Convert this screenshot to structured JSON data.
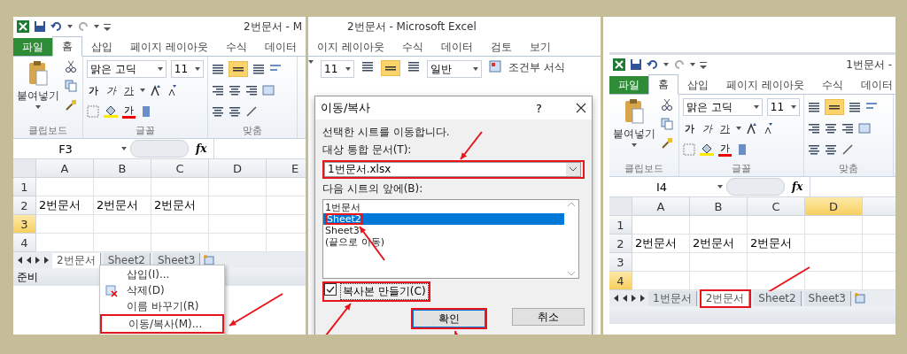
{
  "panels": [
    {
      "kind": "excel",
      "title": "2번문서 - M",
      "ribbon_tabs": [
        {
          "label": "파일",
          "kind": "file",
          "selected": false
        },
        {
          "label": "홈",
          "kind": "tab",
          "selected": true
        },
        {
          "label": "삽입",
          "kind": "tab",
          "selected": false
        },
        {
          "label": "페이지 레이아웃",
          "kind": "tab",
          "selected": false
        },
        {
          "label": "수식",
          "kind": "tab",
          "selected": false
        },
        {
          "label": "데이터",
          "kind": "tab",
          "selected": false
        }
      ],
      "ribbon": {
        "paste": "붙여넣기",
        "font_name": "맑은 고딕",
        "font_size": "11",
        "style_buttons": [
          "가",
          "가",
          "가"
        ],
        "font_color": "가",
        "groups": [
          "클립보드",
          "글꼴",
          "맞춤"
        ]
      },
      "name_box": "F3",
      "fx": "fx",
      "columns": [
        {
          "label": "A",
          "selected": false
        },
        {
          "label": "B",
          "selected": false
        },
        {
          "label": "C",
          "selected": false
        },
        {
          "label": "D",
          "selected": false
        },
        {
          "label": "E",
          "selected": false
        }
      ],
      "rows": [
        {
          "label": "1",
          "selected": false,
          "cells": []
        },
        {
          "label": "2",
          "selected": false,
          "cells": [
            "2번문서",
            "2번문서",
            "2번문서"
          ]
        },
        {
          "label": "3",
          "selected": true,
          "cells": []
        },
        {
          "label": "4",
          "selected": false,
          "cells": []
        }
      ],
      "sheet_tabs": [
        {
          "label": "2번문서",
          "selected": true,
          "highlighted": false
        },
        {
          "label": "Sheet2",
          "selected": false,
          "highlighted": false
        },
        {
          "label": "Sheet3",
          "selected": false,
          "highlighted": false
        }
      ],
      "status": "준비",
      "context_menu": [
        {
          "label": "삽입(I)...",
          "kind": "plain",
          "highlighted": false
        },
        {
          "label": "삭제(D)",
          "kind": "delete",
          "highlighted": false
        },
        {
          "label": "이름 바꾸기(R)",
          "kind": "plain",
          "highlighted": false
        },
        {
          "label": "이동/복사(M)...",
          "kind": "plain",
          "highlighted": true,
          "arrow": {
            "kind": "from-upper-right"
          }
        }
      ]
    },
    {
      "kind": "dialog-step",
      "title": "2번문서 - Microsoft Excel",
      "ribbon_tabs": [
        {
          "label": "이지 레이아웃",
          "kind": "tab",
          "selected": false
        },
        {
          "label": "수식",
          "kind": "tab",
          "selected": false
        },
        {
          "label": "데이터",
          "kind": "tab",
          "selected": false
        },
        {
          "label": "검토",
          "kind": "tab",
          "selected": false
        },
        {
          "label": "보기",
          "kind": "tab",
          "selected": false
        }
      ],
      "ribbon": {
        "font_size": "11",
        "number_format": "일반",
        "conditional_format": "조건부 서식"
      },
      "dialog": {
        "title": "이동/복사",
        "help": "?",
        "message": "선택한 시트를 이동합니다.",
        "book_label": "대상 통합 문서(T):",
        "book": {
          "value": "1번문서.xlsx",
          "highlighted": true,
          "arrow": {
            "kind": "from-above"
          }
        },
        "before_label": "다음 시트의 앞에(B):",
        "sheets": [
          {
            "label": "1번문서",
            "selected": false,
            "highlighted": false
          },
          {
            "label": "Sheet2",
            "selected": true,
            "highlighted": true,
            "arrow": {
              "kind": "from-lower-right"
            }
          },
          {
            "label": "Sheet3",
            "selected": false,
            "highlighted": false
          },
          {
            "label": "(끝으로 이동)",
            "selected": false,
            "highlighted": false
          }
        ],
        "copy": {
          "label": "복사본 만들기(C)",
          "checked": true,
          "highlighted": true,
          "arrow": {
            "kind": "from-lower-left"
          }
        },
        "buttons": [
          {
            "label": "확인",
            "kind": "default",
            "highlighted": true,
            "arrow": {
              "kind": "from-below"
            }
          },
          {
            "label": "취소",
            "kind": "normal",
            "highlighted": false
          }
        ]
      }
    },
    {
      "kind": "window",
      "title": "1번문서 -",
      "ribbon_tabs": [
        {
          "label": "파일",
          "kind": "file",
          "selected": false
        },
        {
          "label": "홈",
          "kind": "tab",
          "selected": true
        },
        {
          "label": "삽입",
          "kind": "tab",
          "selected": false
        },
        {
          "label": "페이지 레이아웃",
          "kind": "tab",
          "selected": false
        },
        {
          "label": "수식",
          "kind": "tab",
          "selected": false
        },
        {
          "label": "데이터",
          "kind": "tab",
          "selected": false
        }
      ],
      "ribbon": {
        "paste": "붙여넣기",
        "font_name": "맑은 고딕",
        "font_size": "11",
        "style_buttons": [
          "가",
          "가",
          "가"
        ],
        "font_color": "가",
        "groups": [
          "클립보드",
          "글꼴",
          "맞춤"
        ]
      },
      "name_box": "I4",
      "fx": "fx",
      "columns": [
        {
          "label": "A",
          "selected": false
        },
        {
          "label": "B",
          "selected": false
        },
        {
          "label": "C",
          "selected": false
        },
        {
          "label": "D",
          "selected": true
        }
      ],
      "rows": [
        {
          "label": "1",
          "selected": false,
          "cells": []
        },
        {
          "label": "2",
          "selected": false,
          "cells": [
            "2번문서",
            "2번문서",
            "2번문서"
          ]
        },
        {
          "label": "3",
          "selected": false,
          "cells": []
        },
        {
          "label": "4",
          "selected": true,
          "cells": []
        }
      ],
      "sheet_tabs": [
        {
          "label": "1번문서",
          "selected": false,
          "highlighted": false
        },
        {
          "label": "2번문서",
          "selected": true,
          "highlighted": true,
          "arrow": {
            "kind": "from-upper-right"
          }
        },
        {
          "label": "Sheet2",
          "selected": false,
          "highlighted": false
        },
        {
          "label": "Sheet3",
          "selected": false,
          "highlighted": false
        }
      ]
    }
  ]
}
